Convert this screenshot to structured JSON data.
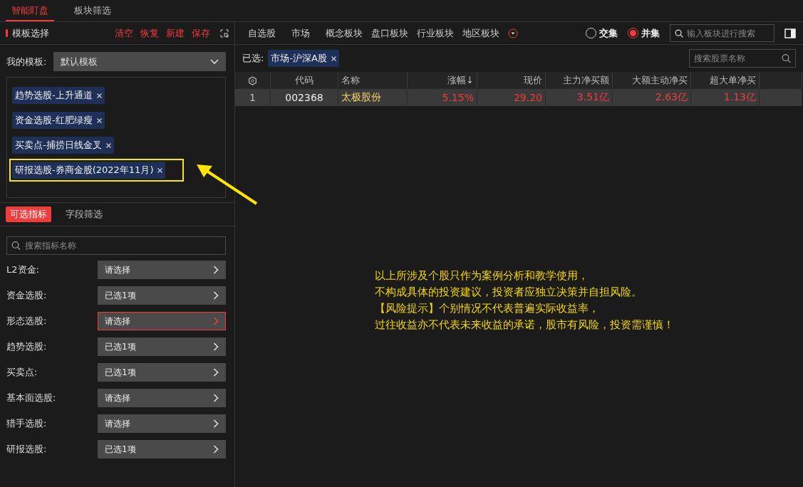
{
  "top_tabs": [
    {
      "label": "智能盯盘",
      "selected": true
    },
    {
      "label": "板块筛选",
      "selected": false
    }
  ],
  "template_panel": {
    "title": "模板选择",
    "actions": [
      "清空",
      "恢复",
      "新建",
      "保存"
    ],
    "my_template_label": "我的模板:",
    "my_template_value": "默认模板",
    "tags": [
      {
        "label": "趋势选股-上升通道",
        "highlighted": false
      },
      {
        "label": "资金选股-红肥绿瘦",
        "highlighted": false
      },
      {
        "label": "买卖点-捕捞日线金叉",
        "highlighted": false
      },
      {
        "label": "研报选股-券商金股(2022年11月)",
        "highlighted": true
      }
    ]
  },
  "filter_tabs": [
    {
      "label": "可选指标",
      "selected": true
    },
    {
      "label": "字段筛选",
      "selected": false
    }
  ],
  "indicator_search": {
    "placeholder": "搜索指标名称"
  },
  "filters": [
    {
      "label": "L2资金:",
      "value": "请选择",
      "focused": false
    },
    {
      "label": "资金选股:",
      "value": "已选1项",
      "focused": false
    },
    {
      "label": "形态选股:",
      "value": "请选择",
      "focused": true
    },
    {
      "label": "趋势选股:",
      "value": "已选1项",
      "focused": false
    },
    {
      "label": "买卖点:",
      "value": "已选1项",
      "focused": false
    },
    {
      "label": "基本面选股:",
      "value": "请选择",
      "focused": false
    },
    {
      "label": "猎手选股:",
      "value": "请选择",
      "focused": false
    },
    {
      "label": "研报选股:",
      "value": "已选1项",
      "focused": false
    }
  ],
  "nav_tabs": [
    "自选股",
    "市场",
    "概念板块",
    "盘口板块",
    "行业板块",
    "地区板块"
  ],
  "set_mode": [
    {
      "label": "交集",
      "selected": false
    },
    {
      "label": "并集",
      "selected": true
    }
  ],
  "sector_search": {
    "placeholder": "输入板块进行搜索"
  },
  "selected_label": "已选:",
  "selected_tags": [
    "市场-沪深A股"
  ],
  "stock_search": {
    "placeholder": "搜索股票名称"
  },
  "table": {
    "columns": [
      "代码",
      "名称",
      "涨幅↓",
      "现价",
      "主力净买额",
      "大额主动净买",
      "超大单净买"
    ],
    "rows": [
      {
        "index": "1",
        "cells": [
          "002368",
          "太极股份",
          "5.15%",
          "29.20",
          "3.51亿",
          "2.63亿",
          "1.13亿"
        ]
      }
    ]
  },
  "disclaimer": [
    "以上所涉及个股只作为案例分析和教学使用，",
    "不构成具体的投资建议，投资者应独立决策并自担风险。",
    "【风险提示】个别情况不代表普遍实际收益率，",
    "过往收益亦不代表未来收益的承诺，股市有风险，投资需谨慎！"
  ]
}
